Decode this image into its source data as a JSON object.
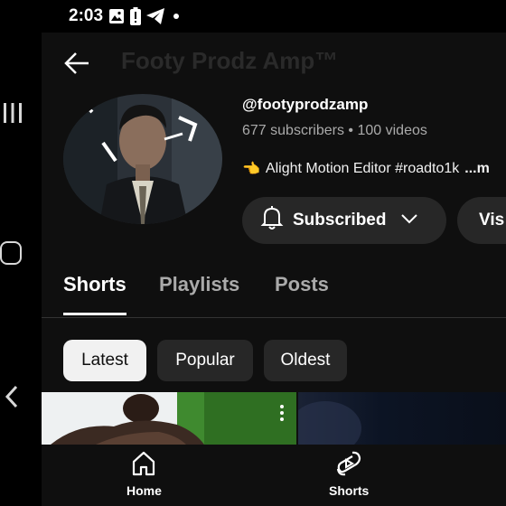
{
  "status_bar": {
    "time": "2:03",
    "icons": [
      "image-icon",
      "battery-alert-icon",
      "telegram-icon",
      "dot-icon"
    ]
  },
  "header": {
    "back_icon": "arrow-left-icon",
    "title": "Footy Prodz Amp™"
  },
  "channel": {
    "handle": "@footyprodzamp",
    "subscribers": "677 subscribers",
    "separator": "•",
    "videos": "100 videos",
    "description": "Alight Motion Editor #roadto1k",
    "description_more": "...m",
    "emoji": "👈"
  },
  "buttons": {
    "subscribed_label": "Subscribed",
    "visit_label": "Vis"
  },
  "tabs": [
    {
      "label": "Shorts",
      "active": true
    },
    {
      "label": "Playlists",
      "active": false
    },
    {
      "label": "Posts",
      "active": false
    }
  ],
  "chips": [
    {
      "label": "Latest",
      "selected": true
    },
    {
      "label": "Popular",
      "selected": false
    },
    {
      "label": "Oldest",
      "selected": false
    }
  ],
  "bottom_nav": [
    {
      "label": "Home",
      "icon": "home-icon"
    },
    {
      "label": "Shorts",
      "icon": "shorts-icon"
    }
  ],
  "colors": {
    "background": "#0f0f0f",
    "button_bg": "#272727",
    "secondary_text": "#aaaaaa",
    "chip_selected_bg": "#f1f1f1"
  }
}
